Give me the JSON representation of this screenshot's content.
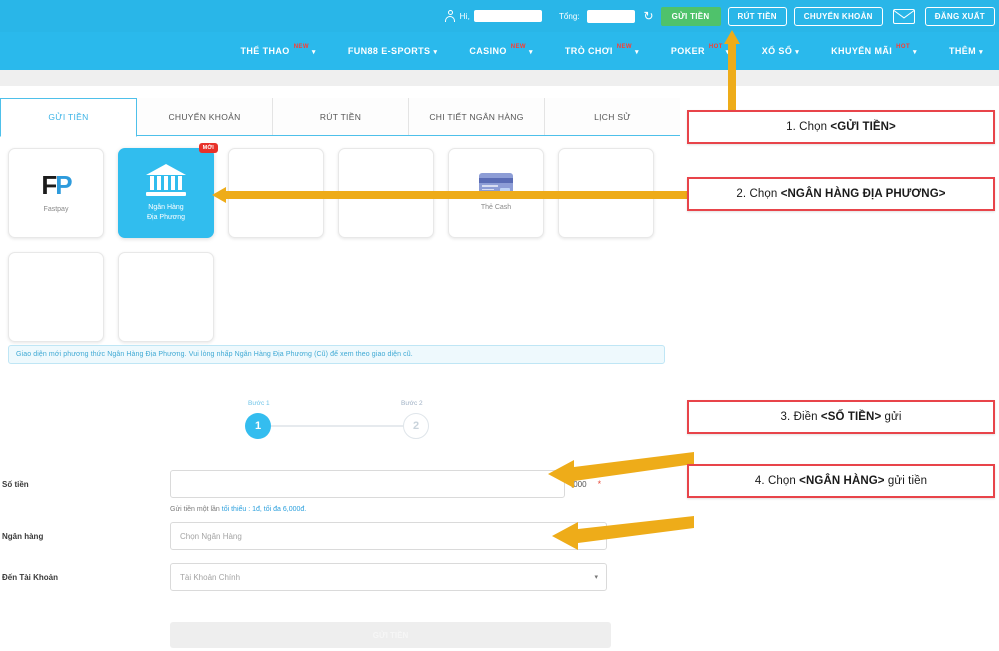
{
  "topbar": {
    "greeting": "Hi,",
    "balance_label": "Tổng:",
    "refresh_icon": "refresh-icon",
    "buttons": [
      {
        "label": "GỬI TIỀN",
        "style": "green"
      },
      {
        "label": "RÚT TIỀN",
        "style": "outline"
      },
      {
        "label": "CHUYỂN KHOẢN",
        "style": "outline"
      }
    ],
    "mail_icon": "mail-icon",
    "logout_label": "ĐĂNG XUẤT"
  },
  "nav": {
    "items": [
      {
        "label": "THỂ THAO",
        "badge": "NEW",
        "caret": true
      },
      {
        "label": "FUN88 E-SPORTS",
        "badge": "",
        "caret": true
      },
      {
        "label": "CASINO",
        "badge": "NEW",
        "caret": true
      },
      {
        "label": "TRÒ CHƠI",
        "badge": "NEW",
        "caret": true
      },
      {
        "label": "POKER",
        "badge": "HOT",
        "caret": true
      },
      {
        "label": "XỔ SỐ",
        "badge": "",
        "caret": true
      },
      {
        "label": "KHUYẾN MÃI",
        "badge": "HOT",
        "caret": true
      },
      {
        "label": "THÊM",
        "badge": "",
        "caret": true
      }
    ]
  },
  "tabs": [
    {
      "label": "GỬI TIỀN",
      "active": true
    },
    {
      "label": "CHUYỂN KHOẢN",
      "active": false
    },
    {
      "label": "RÚT TIỀN",
      "active": false
    },
    {
      "label": "CHI TIẾT NGÂN HÀNG",
      "active": false
    },
    {
      "label": "LỊCH SỬ",
      "active": false
    }
  ],
  "methods": [
    {
      "label": "Fastpay",
      "icon": "fastpay-logo",
      "selected": false,
      "badge": ""
    },
    {
      "label": "Ngân Hàng\nĐịa Phương",
      "label_line1": "Ngân Hàng",
      "label_line2": "Địa Phương",
      "icon": "bank-icon",
      "selected": true,
      "badge": "MỚI"
    },
    {
      "label": "",
      "icon": "",
      "selected": false,
      "badge": ""
    },
    {
      "label": "",
      "icon": "",
      "selected": false,
      "badge": ""
    },
    {
      "label": "Thẻ Cash",
      "icon": "credit-card-icon",
      "selected": false,
      "badge": ""
    },
    {
      "label": "",
      "icon": "",
      "selected": false,
      "badge": ""
    },
    {
      "label": "",
      "icon": "",
      "selected": false,
      "badge": ""
    },
    {
      "label": "",
      "icon": "",
      "selected": false,
      "badge": ""
    }
  ],
  "notice": {
    "text": "Giao diện mới phương thức Ngân Hàng Địa Phương. Vui lòng nhấp Ngân Hàng Địa Phương (Cũ) để xem theo giao diện cũ."
  },
  "stepper": {
    "step1_label": "Bước 1",
    "step1_number": "1",
    "step2_label": "Bước 2",
    "step2_number": "2"
  },
  "form": {
    "amount": {
      "label": "Số tiền",
      "value": "",
      "placeholder": "",
      "suffix": ",000",
      "required_mark": "*",
      "helper_prefix": "Gửi tiền một lần ",
      "helper_highlight": "tối thiểu : 1đ, tối đa 6,000đ."
    },
    "bank": {
      "label": "Ngân hàng",
      "selected": "Chọn Ngân Hàng",
      "required_mark": "*",
      "caret": "chevron-down-icon"
    },
    "account": {
      "label": "Đến Tài Khoản",
      "selected": "Tài Khoản Chính",
      "caret": "chevron-down-icon"
    },
    "submit_label": "GỬI TIỀN"
  },
  "annotations": [
    {
      "prefix": "1. Chọn ",
      "strong": "<GỬI TIỀN>",
      "suffix": ""
    },
    {
      "prefix": "2. Chọn ",
      "strong": "<NGÂN HÀNG ĐỊA PHƯƠNG>",
      "suffix": ""
    },
    {
      "prefix": "3. Điền ",
      "strong": "<SỐ TIỀN>",
      "suffix": " gửi"
    },
    {
      "prefix": "4. Chọn ",
      "strong": "<NGÂN HÀNG>",
      "suffix": " gửi tiền"
    }
  ],
  "colors": {
    "header_blue": "#29b6e8",
    "nav_blue": "#2ab9ec",
    "accent_green": "#4fc26b",
    "selected_card": "#31bdee",
    "arrow_yellow": "#eeac19",
    "annotation_border": "#e8444a",
    "badge_red": "#e8322a"
  }
}
